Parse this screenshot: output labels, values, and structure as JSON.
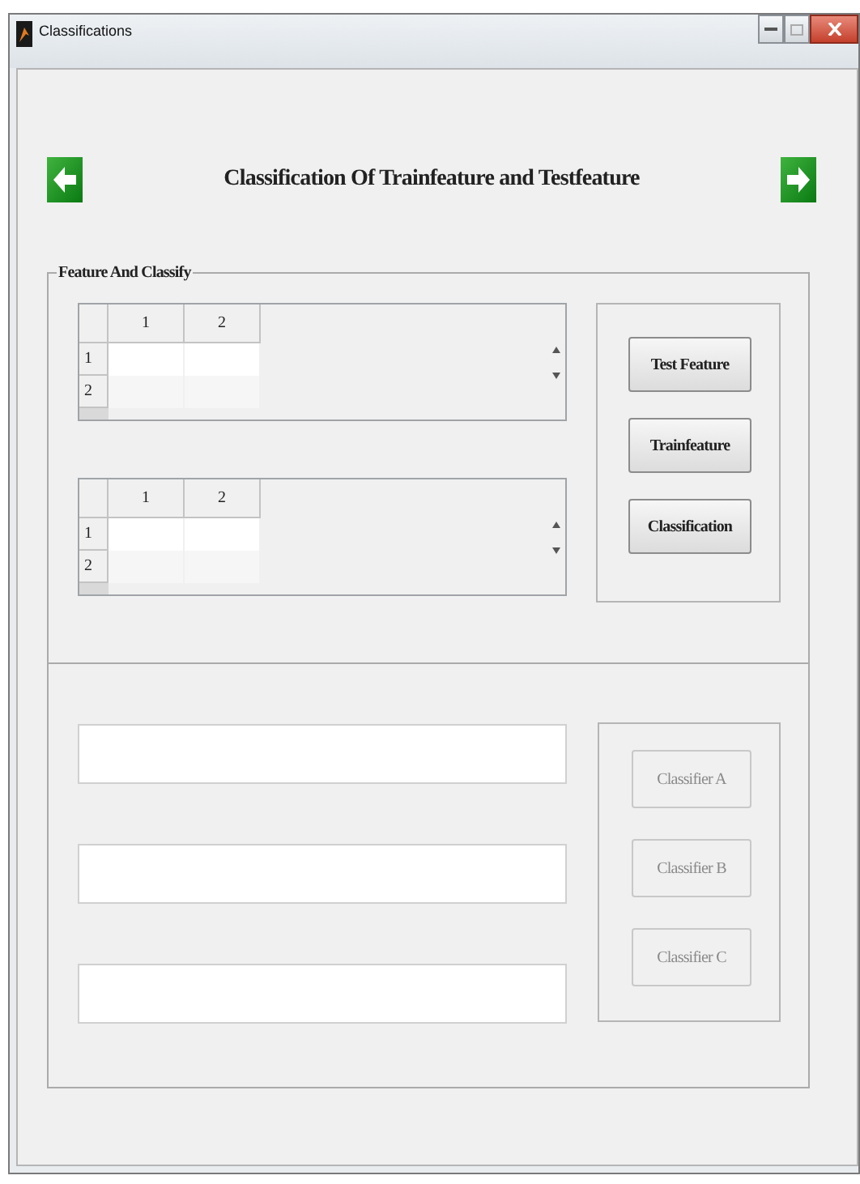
{
  "window": {
    "title": "Classifications"
  },
  "heading": "Classification Of Trainfeature and Testfeature",
  "feature_panel": {
    "title": "Feature And Classify",
    "tables": [
      {
        "columns": [
          "1",
          "2"
        ],
        "rows": [
          "1",
          "2"
        ]
      },
      {
        "columns": [
          "1",
          "2"
        ],
        "rows": [
          "1",
          "2"
        ]
      }
    ],
    "buttons": [
      {
        "label": "Test Feature",
        "disabled": false
      },
      {
        "label": "Trainfeature",
        "disabled": false
      },
      {
        "label": "Classification",
        "disabled": false
      }
    ]
  },
  "result_panel": {
    "fields": [
      {
        "kind": "text"
      },
      {
        "kind": "text"
      },
      {
        "kind": "text"
      }
    ],
    "buttons": [
      {
        "label": "Classifier A",
        "disabled": true
      },
      {
        "label": "Classifier B",
        "disabled": true
      },
      {
        "label": "Classifier C",
        "disabled": true
      }
    ]
  }
}
